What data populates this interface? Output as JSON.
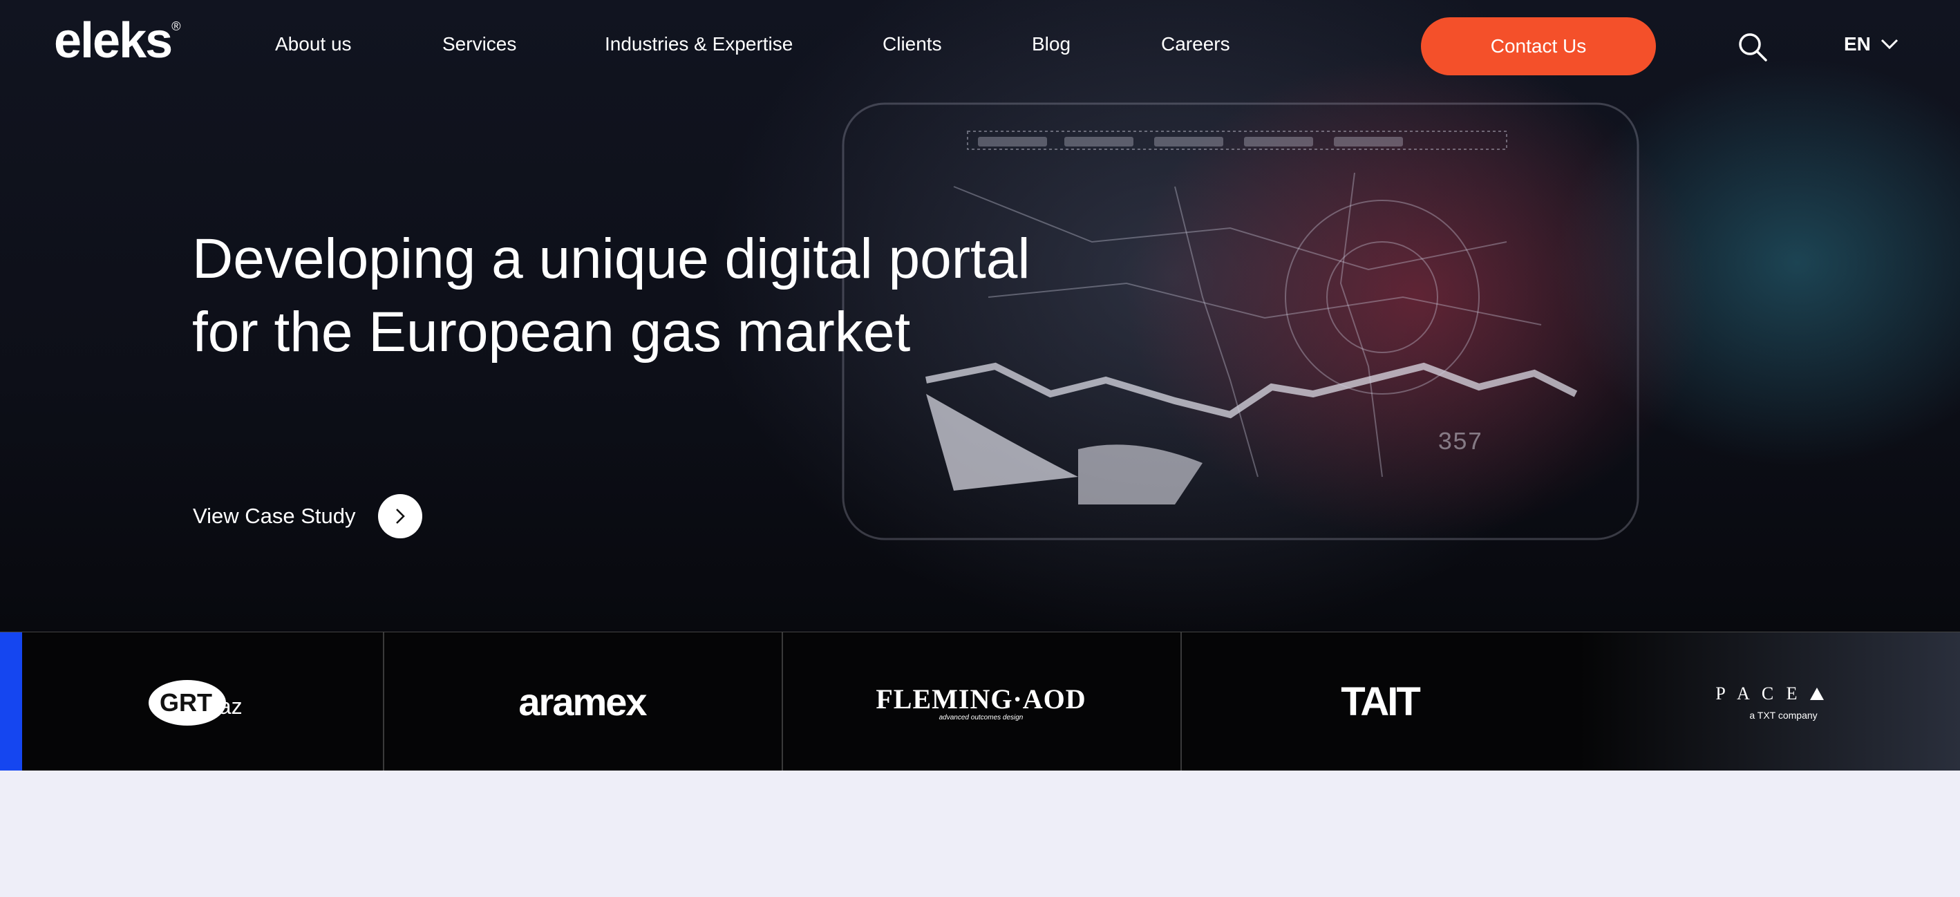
{
  "brand": {
    "name": "eleks",
    "mark": "®"
  },
  "nav": {
    "items": [
      "About us",
      "Services",
      "Industries & Expertise",
      "Clients",
      "Blog",
      "Careers"
    ],
    "contact_label": "Contact Us",
    "language": "EN"
  },
  "hero": {
    "headline_line1": "Developing a unique digital portal",
    "headline_line2": "for the European gas market",
    "cta_label": "View Case Study"
  },
  "client_logos": [
    {
      "name": "GRTgaz",
      "text_a": "GRT",
      "text_b": "gaz"
    },
    {
      "name": "aramex",
      "text": "aramex"
    },
    {
      "name": "FLEMING-AOD",
      "text": "FLEMING·AOD",
      "tagline": "advanced outcomes design"
    },
    {
      "name": "TAIT",
      "text": "TAIT"
    },
    {
      "name": "PACE",
      "text": "P A C E",
      "tagline": "a TXT company"
    }
  ],
  "colors": {
    "accent": "#f4502a",
    "slider_indicator": "#1546f0",
    "page_bg": "#eeeef8"
  },
  "icons": {
    "search": "search-icon",
    "language_toggle": "chevron-down-icon",
    "cta": "chevron-right-icon"
  }
}
